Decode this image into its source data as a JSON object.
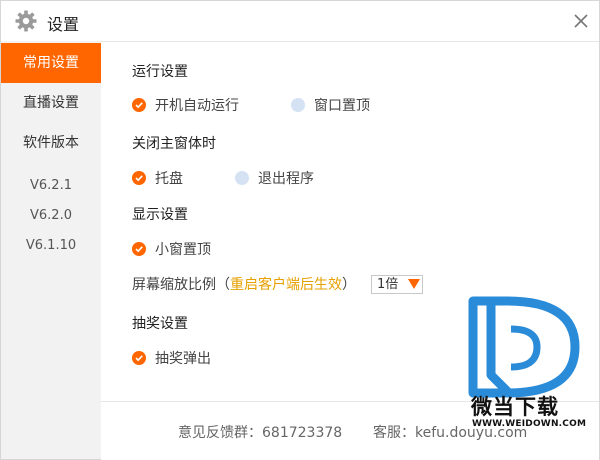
{
  "window": {
    "title": "设置"
  },
  "sidebar": {
    "items": [
      {
        "label": "常用设置",
        "active": true
      },
      {
        "label": "直播设置",
        "active": false
      },
      {
        "label": "软件版本",
        "active": false
      }
    ],
    "versions": [
      "V6.2.1",
      "V6.2.0",
      "V6.1.10"
    ]
  },
  "sections": {
    "run": {
      "title": "运行设置",
      "options": [
        {
          "label": "开机自动运行",
          "checked": true
        },
        {
          "label": "窗口置顶",
          "checked": false
        }
      ]
    },
    "close": {
      "title": "关闭主窗体时",
      "options": [
        {
          "label": "托盘",
          "checked": true
        },
        {
          "label": "退出程序",
          "checked": false
        }
      ]
    },
    "display": {
      "title": "显示设置",
      "options": [
        {
          "label": "小窗置顶",
          "checked": true
        }
      ],
      "scale_label": "屏幕缩放比例（",
      "scale_hint": "重启客户端后生效",
      "scale_close": "）",
      "scale_value": "1倍"
    },
    "lottery": {
      "title": "抽奖设置",
      "options": [
        {
          "label": "抽奖弹出",
          "checked": true
        }
      ]
    }
  },
  "footer": {
    "feedback": "意见反馈群：681723378",
    "service": "客服：kefu.douyu.com"
  },
  "watermark": {
    "text": "微当下载",
    "url": "WWW.WEIDOWN.COM"
  },
  "colors": {
    "accent": "#ff6600",
    "hint": "#e6a100",
    "logo_blue": "#2a8bd8"
  }
}
